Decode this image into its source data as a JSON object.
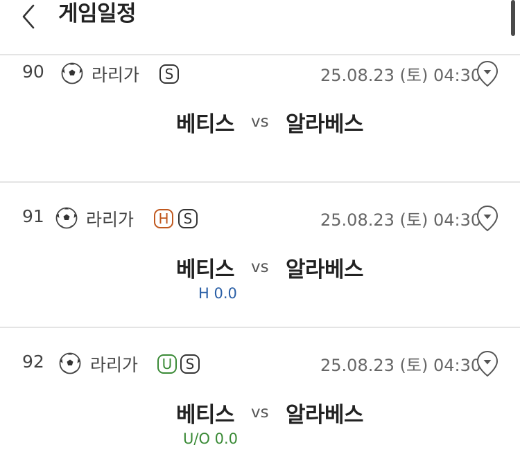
{
  "header": {
    "title": "게임일정",
    "back_icon": "chevron-left-icon"
  },
  "games": [
    {
      "number": "90",
      "league": "라리가",
      "badges": [
        "S"
      ],
      "datetime": "25.08.23 (토) 04:30",
      "home": "베티스",
      "vs": "vs",
      "away": "알라베스",
      "odds": ""
    },
    {
      "number": "91",
      "league": "라리가",
      "badges": [
        "H",
        "S"
      ],
      "datetime": "25.08.23 (토) 04:30",
      "home": "베티스",
      "vs": "vs",
      "away": "알라베스",
      "odds": "H 0.0"
    },
    {
      "number": "92",
      "league": "라리가",
      "badges": [
        "U",
        "S"
      ],
      "datetime": "25.08.23 (토) 04:30",
      "home": "베티스",
      "vs": "vs",
      "away": "알라베스",
      "odds": "U/O 0.0"
    }
  ],
  "colors": {
    "handicap_badge": "#c0581e",
    "underover_badge": "#3a8a36",
    "handicap_odds": "#2a5fa6",
    "underover_odds": "#3a8a36",
    "divider": "#e4e4e4"
  }
}
